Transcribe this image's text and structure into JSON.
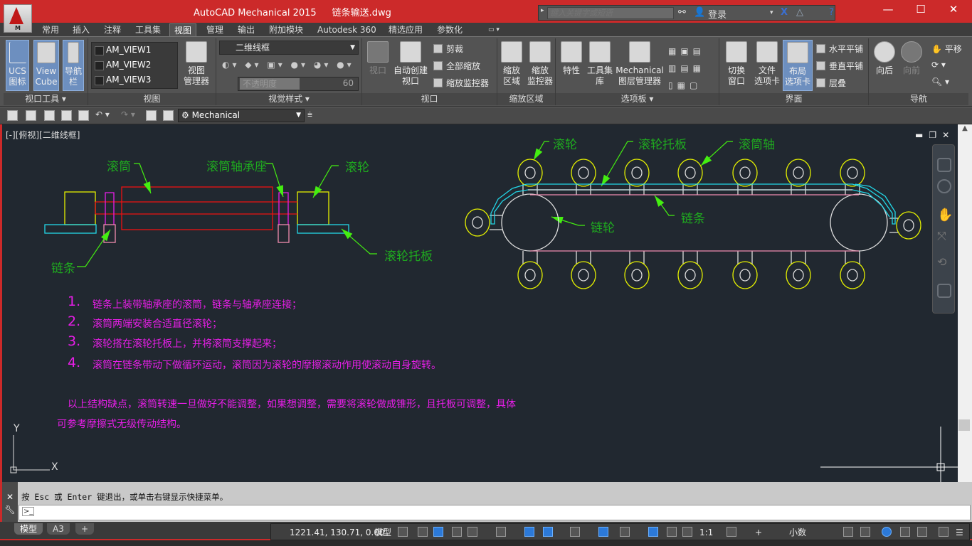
{
  "app": {
    "title": "AutoCAD Mechanical 2015",
    "file": "链条输送.dwg",
    "app_button_letter": "M"
  },
  "search": {
    "placeholder": "键入关键字或短语",
    "login": "登录"
  },
  "tabs": [
    "常用",
    "插入",
    "注释",
    "工具集",
    "视图",
    "管理",
    "输出",
    "附加模块",
    "Autodesk 360",
    "精选应用",
    "参数化"
  ],
  "active_tab": "视图",
  "ribbon": {
    "viewport_tools": {
      "label": "视口工具",
      "ucs": "UCS\n图标",
      "viewcube": "View\nCube",
      "navbar": "导航\n栏"
    },
    "views": {
      "label": "视图",
      "items": [
        "AM_VIEW1",
        "AM_VIEW2",
        "AM_VIEW3"
      ],
      "manager": "视图\n管理器"
    },
    "visual_styles": {
      "label": "视觉样式",
      "current": "二维线框",
      "opacity_label": "不透明度",
      "opacity_value": "60"
    },
    "viewports": {
      "label": "视口",
      "viewport": "视口",
      "auto_create": "自动创建\n视口",
      "clip": "剪裁",
      "zoom_all": "全部缩放",
      "zoom_monitor": "缩放监控器"
    },
    "zoom_region": {
      "label": "缩放区域",
      "zoom_region": "缩放\n区域",
      "zoom_monitor": "缩放\n监控器"
    },
    "palettes": {
      "label": "选项板",
      "properties": "特性",
      "tool_palettes": "工具集\n库",
      "layer_manager": "Mechanical\n图层管理器"
    },
    "interface": {
      "label": "界面",
      "switch_windows": "切换\n窗口",
      "file_tabs": "文件\n选项卡",
      "layout_tabs": "布局\n选项卡",
      "tile_h": "水平平铺",
      "tile_v": "垂直平铺",
      "cascade": "层叠"
    },
    "navigate": {
      "label": "导航",
      "back": "向后",
      "forward": "向前",
      "pan": "平移"
    }
  },
  "qat": {
    "workspace": "Mechanical"
  },
  "viewport": {
    "label": "[-][俯视][二维线框]"
  },
  "drawing": {
    "left_labels": {
      "drum": "滚筒",
      "bearing": "滚筒轴承座",
      "roller": "滚轮",
      "chain": "链条",
      "roller_plate": "滚轮托板"
    },
    "right_labels": {
      "roller": "滚轮",
      "roller_plate": "滚轮托板",
      "drum_shaft": "滚筒轴",
      "sprocket": "链轮",
      "chain": "链条"
    },
    "notes": [
      {
        "num": "1.",
        "text": "链条上装带轴承座的滚筒，链条与轴承座连接；"
      },
      {
        "num": "2.",
        "text": "滚筒两端安装合适直径滚轮；"
      },
      {
        "num": "3.",
        "text": "滚轮搭在滚轮托板上，并将滚筒支撑起来；"
      },
      {
        "num": "4.",
        "text": "滚筒在链条带动下做循环运动，滚筒因为滚轮的摩擦滚动作用使滚动自身旋转。"
      }
    ],
    "remark_line1": "以上结构缺点，滚筒转速一旦做好不能调整，如果想调整，需要将滚轮做成锥形，且托板可调整，具体",
    "remark_line2": "可参考摩擦式无级传动结构。",
    "ucs_x": "X",
    "ucs_y": "Y",
    "colors": {
      "label": "#1faa1f",
      "leader": "#44ee11",
      "note": "#e81ee8",
      "roller": "#e4f000",
      "plate": "#22d8e8",
      "drum": "#ee1111",
      "chain": "#f08cb0",
      "background": "#212830"
    }
  },
  "command": {
    "history": "按 Esc 或 Enter 键退出，或单击右键显示快捷菜单。",
    "input": "",
    "prompt": ">_"
  },
  "layout_tabs": [
    "模型",
    "A3",
    "+"
  ],
  "status": {
    "coords": "1221.41, 130.71, 0.00",
    "model": "模型",
    "scale": "1:1",
    "units": "小数"
  }
}
